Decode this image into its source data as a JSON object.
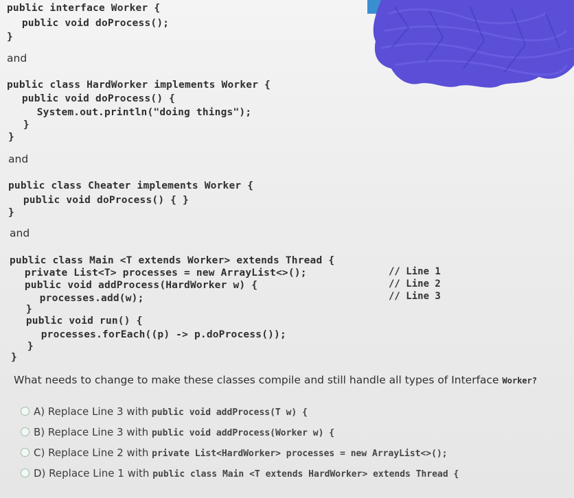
{
  "code_blocks": {
    "worker": [
      "public interface Worker {",
      "  public void doProcess();",
      "}"
    ],
    "and1": "and",
    "hardworker": [
      "public class HardWorker implements Worker {",
      "  public void doProcess() {",
      "    System.out.println(\"doing things\");",
      "  }",
      "}"
    ],
    "and2": "and",
    "cheater": [
      "public class Cheater implements Worker {",
      "  public void doProcess() { }",
      "}"
    ],
    "and3": "and",
    "main": [
      "public class Main <T extends Worker> extends Thread {",
      "  private List<T> processes = new ArrayList<>();",
      "  public void addProcess(HardWorker w) {",
      "    processes.add(w);",
      "  }",
      "  public void run() {",
      "    processes.forEach((p) -> p.doProcess());",
      "  }",
      "}"
    ],
    "line_comments": [
      "// Line 1",
      "// Line 2",
      "// Line 3"
    ]
  },
  "question": {
    "text": "What needs to change to make these classes compile and still handle all types of Interface ",
    "code": "Worker?"
  },
  "options": [
    {
      "label": "A) Replace Line 3 with ",
      "code": "public void addProcess(T w) {"
    },
    {
      "label": "B) Replace Line 3 with ",
      "code": "public void addProcess(Worker w) {"
    },
    {
      "label": "C) Replace Line 2 with ",
      "code": "private List<HardWorker> processes = new ArrayList<>();"
    },
    {
      "label": "D) Replace Line 1 with ",
      "code": "public class Main <T extends HardWorker> extends Thread {"
    }
  ],
  "colors": {
    "scribble": "#5a4fd6",
    "accent_bar": "#3a8fd0",
    "radio": "#9bbfa8"
  }
}
